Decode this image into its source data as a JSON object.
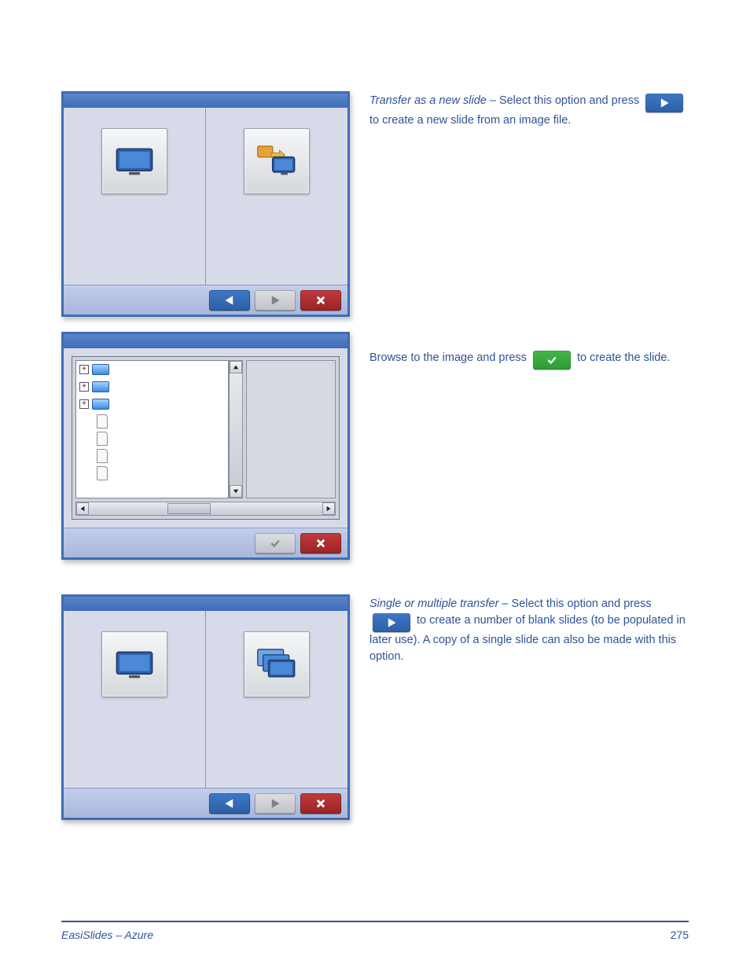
{
  "steps": [
    {
      "lead": "Transfer as a new slide –",
      "body": " Select this option and press ",
      "trail": " to create a new slide from an image file."
    },
    {
      "lead": "",
      "body": "Browse to the image and press ",
      "trail": " to create the slide."
    },
    {
      "lead": "Single or multiple transfer –",
      "body": " Select this option and press ",
      "trail": " to create a number of blank slides (to be populated in later use). A copy of a single slide can also be made with this option."
    }
  ],
  "footer": {
    "title": "EasiSlides – Azure",
    "page": "275"
  },
  "icons": {
    "monitor": "monitor-icon",
    "transfer_folder": "folder-to-monitor-icon",
    "stack": "monitor-stack-icon"
  },
  "buttons": {
    "prev": "previous",
    "next": "next",
    "cancel": "cancel",
    "ok": "ok"
  },
  "colors": {
    "accent_blue": "#2d5fa5",
    "accent_green": "#2e9b34",
    "accent_red": "#9a2325",
    "frame_blue": "#3e6db8"
  }
}
